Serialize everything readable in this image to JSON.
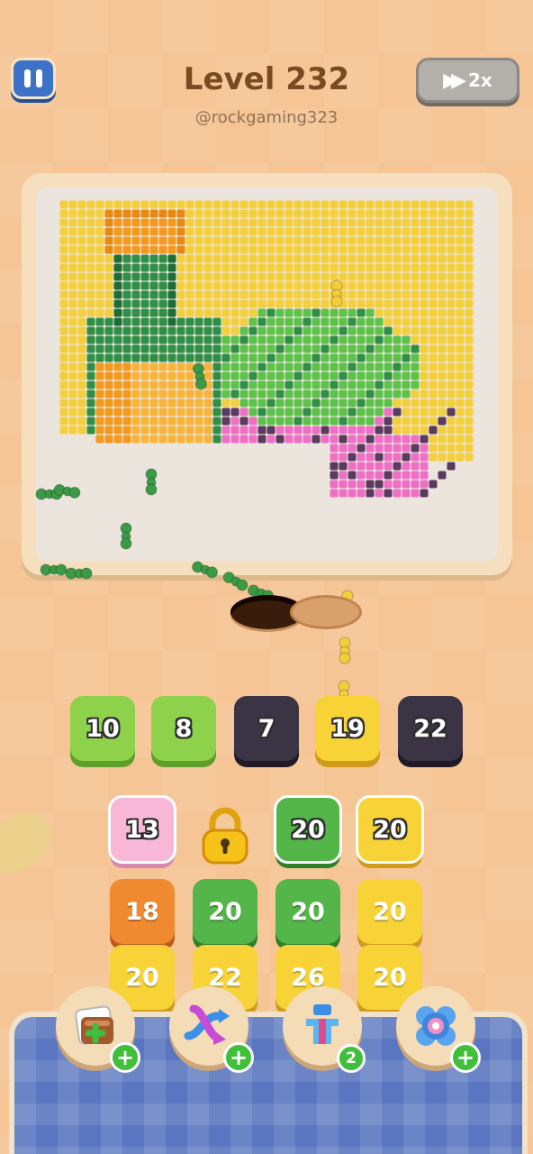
{
  "header": {
    "level_title": "Level 232",
    "username": "@rockgaming323",
    "speed_label": "2x"
  },
  "colors": {
    "lime": "#8ed24c",
    "dark": "#3b3444",
    "yellow": "#f7d338",
    "pink": "#f9b7d7",
    "green": "#54b548",
    "orange": "#f08a30",
    "tray_blue": "#5a76c0",
    "ant_green": "#3a9a45",
    "ant_yellow": "#f2cf3a"
  },
  "icons": {
    "pause": "pause-icon",
    "speed": "fast-forward-icon",
    "lock": "padlock-icon",
    "boosters": [
      "add-slot-icon",
      "shuffle-arrows-icon",
      "magnet-claw-icon",
      "donut-icon"
    ]
  },
  "queue_tiles": [
    {
      "value": "10",
      "color": "lime"
    },
    {
      "value": "8",
      "color": "lime"
    },
    {
      "value": "7",
      "color": "dark"
    },
    {
      "value": "19",
      "color": "yellow"
    },
    {
      "value": "22",
      "color": "dark"
    }
  ],
  "grid_tiles": {
    "row1": [
      {
        "value": "13",
        "color": "pink"
      },
      {
        "value": "",
        "color": "locked"
      },
      {
        "value": "20",
        "color": "green"
      },
      {
        "value": "20",
        "color": "yellow"
      }
    ],
    "row2": [
      {
        "value": "18",
        "color": "orange"
      },
      {
        "value": "20",
        "color": "green"
      },
      {
        "value": "20",
        "color": "green"
      },
      {
        "value": "20",
        "color": "yellow"
      }
    ],
    "row3": [
      {
        "value": "20",
        "color": "yellow"
      },
      {
        "value": "22",
        "color": "yellow"
      },
      {
        "value": "26",
        "color": "yellow"
      },
      {
        "value": "20",
        "color": "yellow"
      }
    ]
  },
  "boosters": [
    {
      "name": "add-slot",
      "badge": "+"
    },
    {
      "name": "shuffle",
      "badge": "+"
    },
    {
      "name": "magnet",
      "badge": "2"
    },
    {
      "name": "donut",
      "badge": "+"
    }
  ]
}
